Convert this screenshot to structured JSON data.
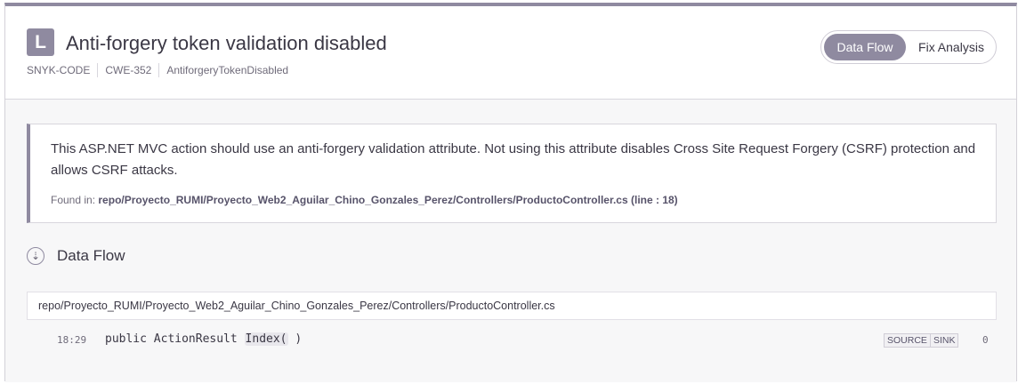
{
  "issue": {
    "severity_letter": "L",
    "title": "Anti-forgery token validation disabled",
    "meta": [
      "SNYK-CODE",
      "CWE-352",
      "AntiforgeryTokenDisabled"
    ]
  },
  "view_toggle": {
    "options": [
      "Data Flow",
      "Fix Analysis"
    ],
    "selected": "Data Flow"
  },
  "description": {
    "text": "This ASP.NET MVC action should use an anti-forgery validation attribute. Not using this attribute disables Cross Site Request Forgery (CSRF) protection and allows CSRF attacks.",
    "found_label": "Found in:",
    "found_path": "repo/Proyecto_RUMI/Proyecto_Web2_Aguilar_Chino_Gonzales_Perez/Controllers/ProductoController.cs (line : 18)"
  },
  "data_flow": {
    "icon": "arrow-down-icon",
    "title": "Data Flow",
    "file": "repo/Proyecto_RUMI/Proyecto_Web2_Aguilar_Chino_Gonzales_Perez/Controllers/ProductoController.cs",
    "steps": [
      {
        "line": "18:29",
        "code_before": "public ActionResult ",
        "code_highlight": "Index(",
        "code_after": " )",
        "tags": [
          "SOURCE",
          "SINK"
        ],
        "index": "0"
      }
    ]
  },
  "colors": {
    "accent": "#8f8aa0",
    "text": "#3a3744",
    "muted": "#6f6b7a"
  }
}
